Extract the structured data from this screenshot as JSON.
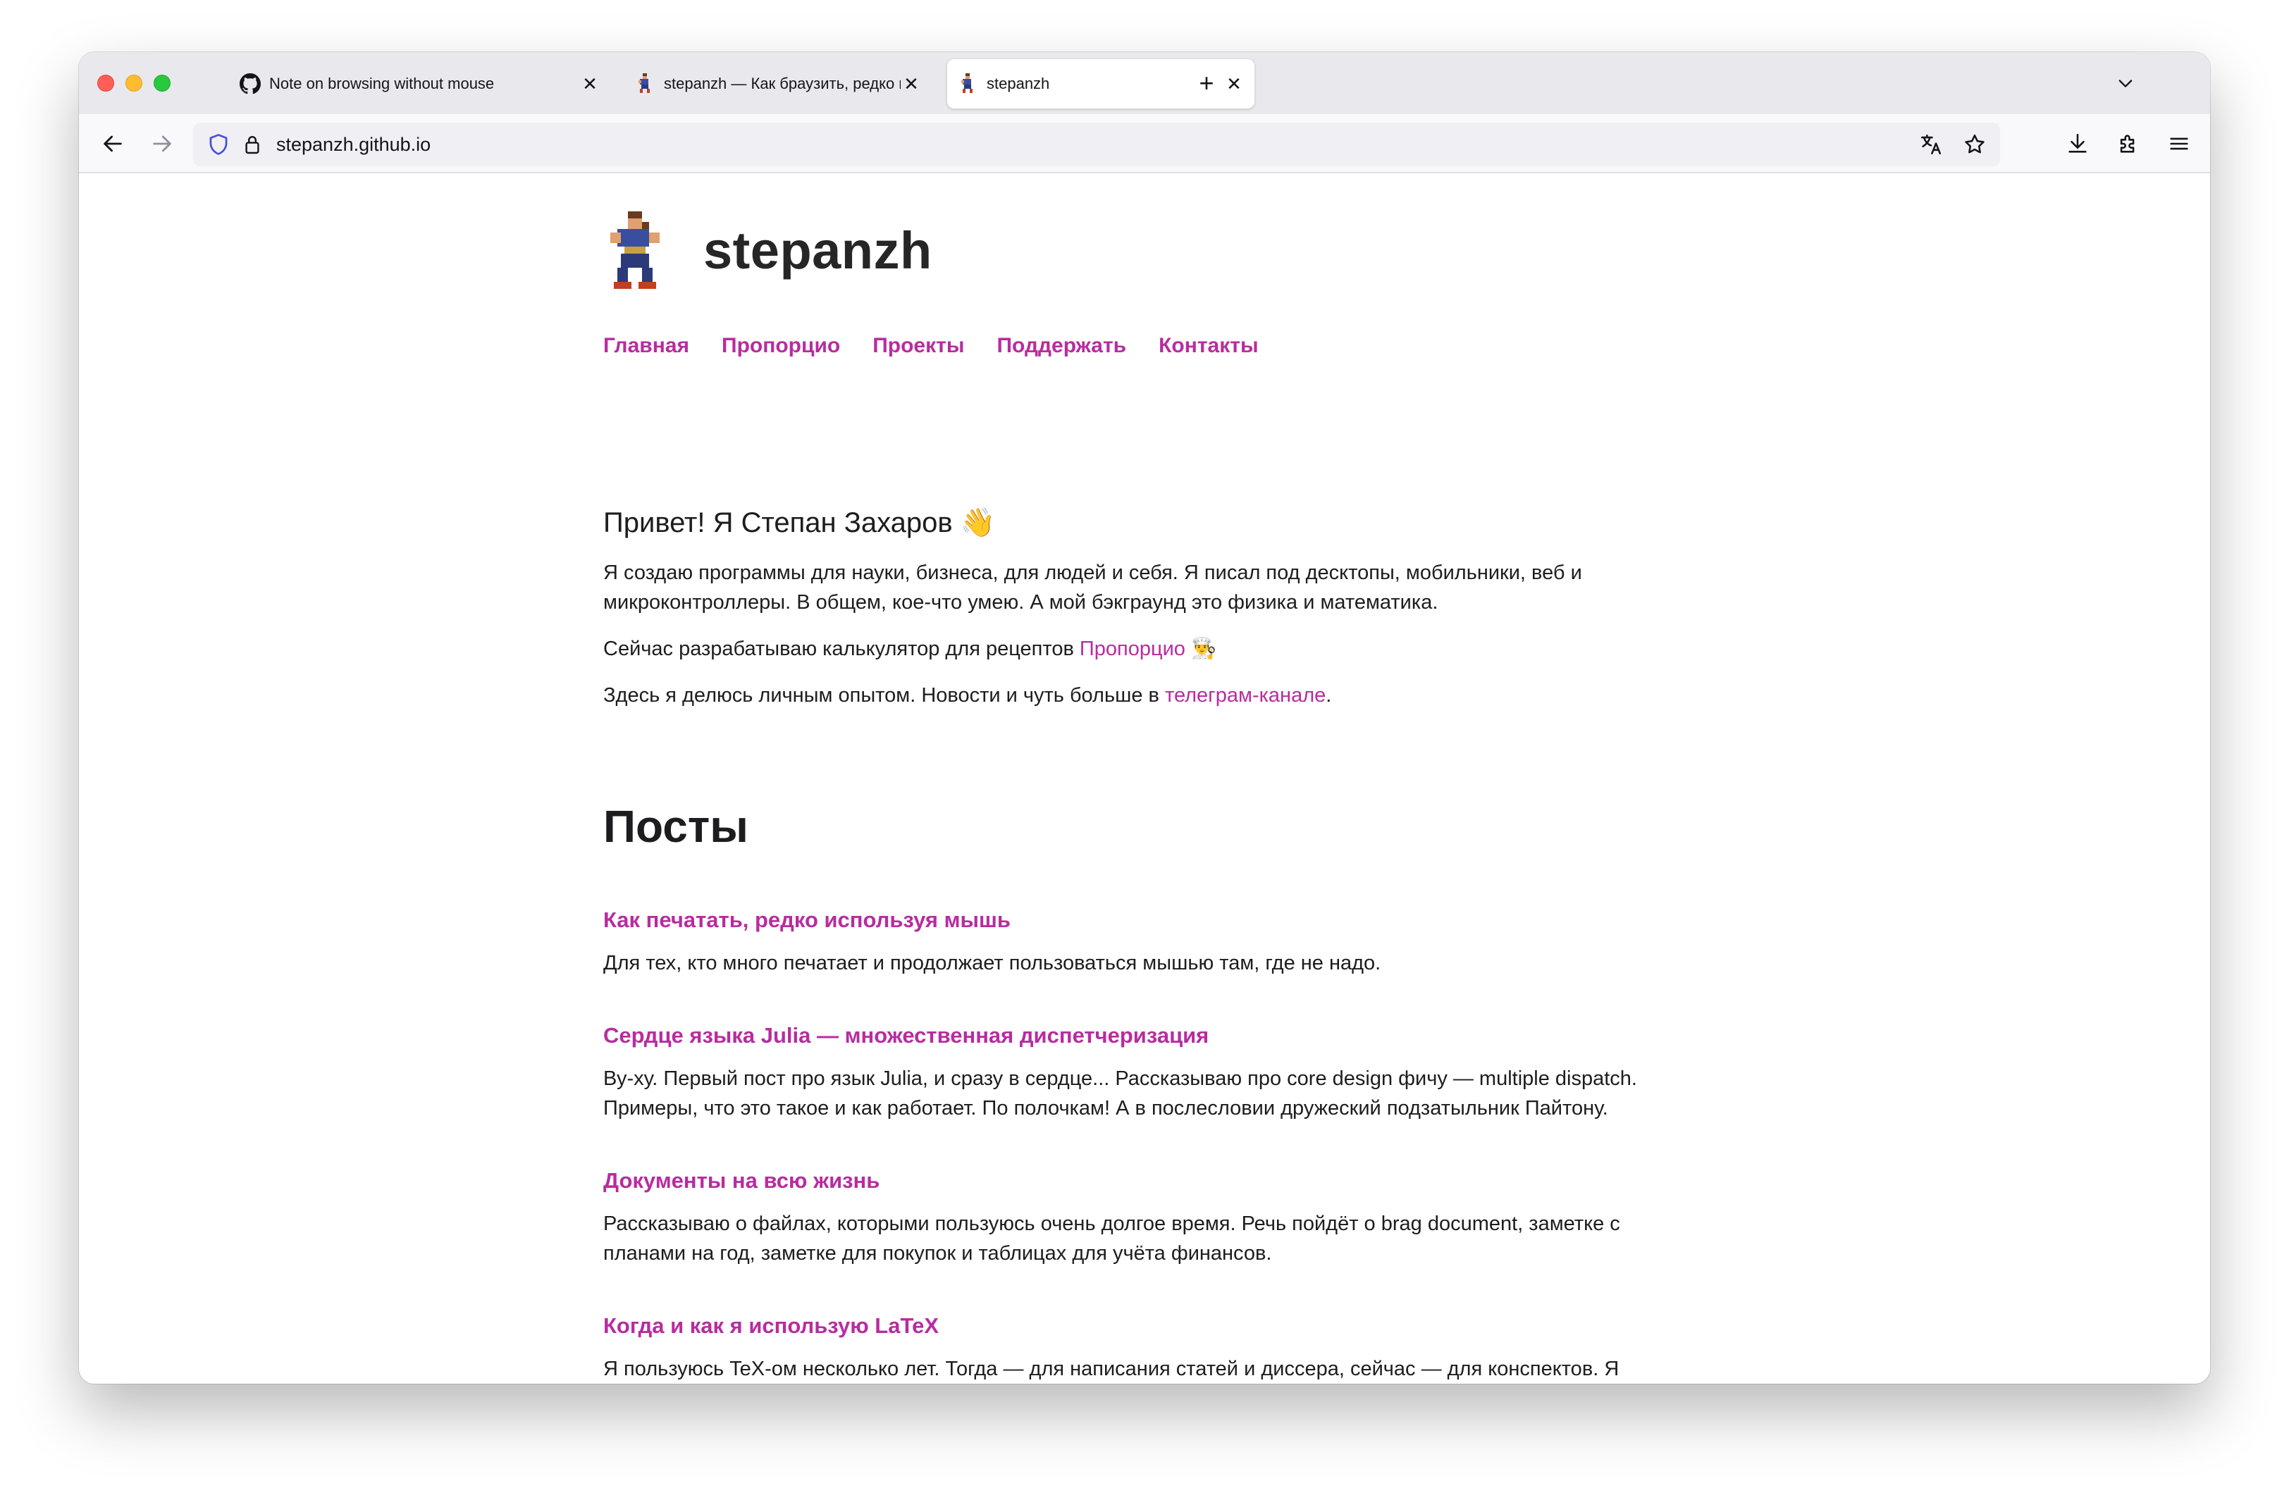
{
  "browser": {
    "tabs": [
      {
        "title": "Note on browsing without mouse",
        "favicon": "github-icon",
        "active": false
      },
      {
        "title": "stepanzh — Как браузить, редко используя мышь",
        "favicon": "pixel-runner-icon",
        "active": false
      },
      {
        "title": "stepanzh",
        "favicon": "pixel-runner-icon",
        "active": true
      }
    ],
    "new_tab_label": "+",
    "close_label": "✕",
    "url": "stepanzh.github.io"
  },
  "site": {
    "name": "stepanzh",
    "nav": [
      "Главная",
      "Пропорцио",
      "Проекты",
      "Поддержать",
      "Контакты"
    ]
  },
  "intro": {
    "greeting": "Привет! Я Степан Захаров",
    "greeting_emoji": "👋",
    "p1": "Я создаю программы для науки, бизнеса, для людей и себя. Я писал под десктопы, мобильники, веб и микроконтроллеры. В общем, кое-что умею. А мой бэкграунд это физика и математика.",
    "p2_prefix": "Сейчас разрабатываю калькулятор для рецептов ",
    "p2_link": "Пропорцио",
    "p2_emoji": "👨‍🍳",
    "p3_prefix": "Здесь я делюсь личным опытом. Новости и чуть больше в ",
    "p3_link": "телеграм-канале",
    "p3_suffix": "."
  },
  "posts": {
    "heading": "Посты",
    "items": [
      {
        "title": "Как печатать, редко используя мышь",
        "desc": "Для тех, кто много печатает и продолжает пользоваться мышью там, где не надо."
      },
      {
        "title": "Сердце языка Julia — множественная диспетчеризация",
        "desc": "Ву-ху. Первый пост про язык Julia, и сразу в сердце... Рассказываю про core design фичу — multiple dispatch. Примеры, что это такое и как работает. По полочкам! А в послесловии дружеский подзатыльник Пайтону."
      },
      {
        "title": "Документы на всю жизнь",
        "desc": "Рассказываю о файлах, которыми пользуюсь очень долгое время. Речь пойдёт о brag document, заметке с планами на год, заметке для покупок и таблицах для учёта финансов."
      },
      {
        "title": "Когда и как я использую LaTeX",
        "desc": "Я пользуюсь TeX-ом несколько лет. Тогда — для написания статей и диссера, сейчас — для конспектов. Я пробовал и другие инструменты, но вернулся к TeX-у. Здесь я рассказываю о своём опыте и сетапе, с которым мне комфортно техать."
      }
    ]
  },
  "colors": {
    "accent": "#b82c9f",
    "text": "#1d1d1f"
  }
}
